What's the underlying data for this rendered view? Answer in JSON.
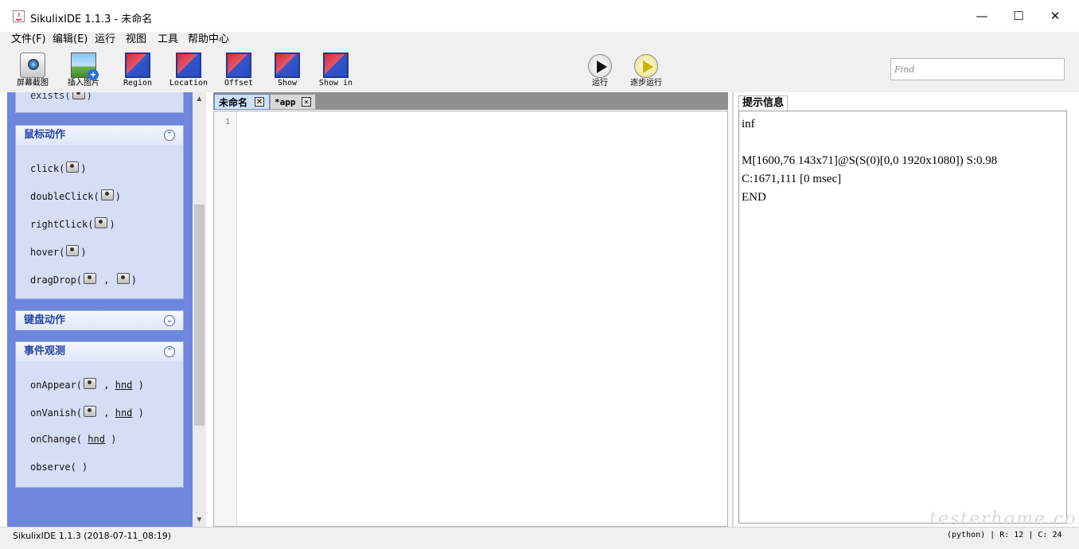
{
  "window": {
    "title": "SikulixIDE 1.1.3 - 未命名",
    "minimize": "—",
    "maximize": "☐",
    "close": "✕"
  },
  "menu": [
    "文件(F)",
    "编辑(E)",
    "运行",
    "视图",
    "工具",
    "帮助中心"
  ],
  "toolbar": {
    "capture": "屏幕截图",
    "insert_image": "插入图片",
    "region": "Region",
    "location": "Location",
    "offset": "Offset",
    "show": "Show",
    "show_in": "Show in",
    "run": "运行",
    "step_run": "逐步运行"
  },
  "find": {
    "placeholder": "Find"
  },
  "palette": {
    "partial_item": "exists(",
    "mouse": {
      "title": "鼠标动作",
      "items": {
        "click": "click(",
        "doubleclick": "doubleClick(",
        "rightclick": "rightClick(",
        "hover": "hover(",
        "dragdrop": "dragDrop("
      }
    },
    "keyboard": {
      "title": "键盘动作"
    },
    "observe": {
      "title": "事件观测",
      "items": {
        "onappear": "onAppear(",
        "onvanish": "onVanish(",
        "onchange": "onChange(",
        "observe": "observe( )"
      },
      "hnd": "hnd"
    },
    "close_paren": ")",
    "comma": ","
  },
  "editor": {
    "tabs": [
      "未命名",
      "*app"
    ],
    "tab_close": "✕",
    "line_numbers": [
      "1"
    ]
  },
  "messages": {
    "tab": "提示信息",
    "lines": [
      "inf",
      "M[1600,76 143x71]@S(S(0)[0,0 1920x1080]) S:0.98",
      "C:1671,111 [0 msec]",
      "END"
    ]
  },
  "status": {
    "left": "SikulixIDE 1.1.3 (2018-07-11_08:19)",
    "right": "(python) | R: 12 | C: 24"
  },
  "watermark": "testerhome.com"
}
